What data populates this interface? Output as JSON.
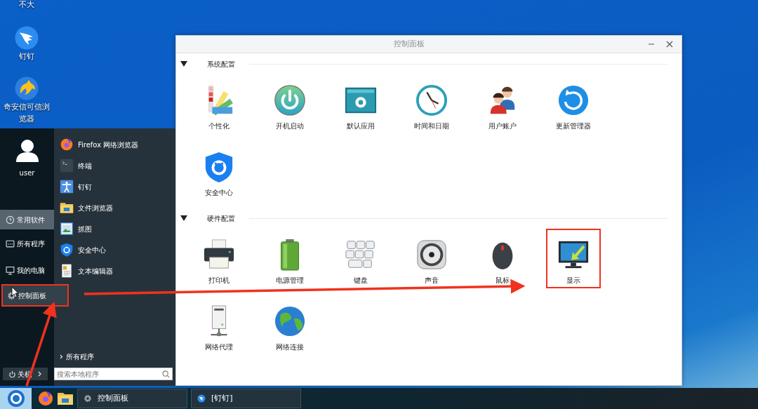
{
  "desktop": {
    "icons": [
      {
        "label": "不大",
        "kind": "offscreen"
      },
      {
        "label": "钉钉",
        "kind": "bird"
      },
      {
        "label": "奇安信可信浏览器",
        "kind": "horse"
      }
    ]
  },
  "start_menu": {
    "user": "user",
    "sections": [
      {
        "label": "常用软件",
        "kind": "clock",
        "selected": true,
        "hovered": false,
        "annotated": false
      },
      {
        "label": "所有程序",
        "kind": "grid",
        "selected": false,
        "hovered": false,
        "annotated": false
      },
      {
        "label": "我的电脑",
        "kind": "monitor",
        "selected": false,
        "hovered": false,
        "annotated": false
      },
      {
        "label": "控制面板",
        "kind": "gear",
        "selected": false,
        "hovered": true,
        "annotated": true
      }
    ],
    "apps": [
      {
        "label": "Firefox 网络浏览器",
        "kind": "firefox"
      },
      {
        "label": "终端",
        "kind": "terminal"
      },
      {
        "label": "钉钉",
        "kind": "person"
      },
      {
        "label": "文件浏览器",
        "kind": "folder"
      },
      {
        "label": "抓图",
        "kind": "picture"
      },
      {
        "label": "安全中心",
        "kind": "shield"
      },
      {
        "label": "文本编辑器",
        "kind": "document"
      }
    ],
    "all_programs": "所有程序",
    "power": "关机",
    "search": {
      "placeholder": "搜索本地程序"
    }
  },
  "taskbar": {
    "tasks": [
      {
        "label": "控制面板",
        "kind": "gear"
      },
      {
        "label": "[钉钉]",
        "kind": "bird"
      }
    ]
  },
  "window": {
    "title": "控制面板",
    "sections": [
      {
        "title": "系统配置",
        "expanded": true,
        "items": [
          {
            "label": "个性化",
            "kind": "palette",
            "annotated": false
          },
          {
            "label": "开机启动",
            "kind": "power",
            "annotated": false
          },
          {
            "label": "默认应用",
            "kind": "appwindow",
            "annotated": false
          },
          {
            "label": "时间和日期",
            "kind": "clock",
            "annotated": false
          },
          {
            "label": "用户账户",
            "kind": "users",
            "annotated": false
          },
          {
            "label": "更新管理器",
            "kind": "refresh",
            "annotated": false
          },
          {
            "label": "安全中心",
            "kind": "shield",
            "annotated": false
          }
        ]
      },
      {
        "title": "硬件配置",
        "expanded": true,
        "items": [
          {
            "label": "打印机",
            "kind": "printer",
            "annotated": false
          },
          {
            "label": "电源管理",
            "kind": "battery",
            "annotated": false
          },
          {
            "label": "键盘",
            "kind": "keyboard",
            "annotated": false
          },
          {
            "label": "声音",
            "kind": "speaker",
            "annotated": false
          },
          {
            "label": "鼠标",
            "kind": "mouse",
            "annotated": false
          },
          {
            "label": "显示",
            "kind": "monitor",
            "annotated": true
          },
          {
            "label": "网络代理",
            "kind": "server",
            "annotated": false
          },
          {
            "label": "网络连接",
            "kind": "globe",
            "annotated": false
          }
        ]
      }
    ]
  }
}
